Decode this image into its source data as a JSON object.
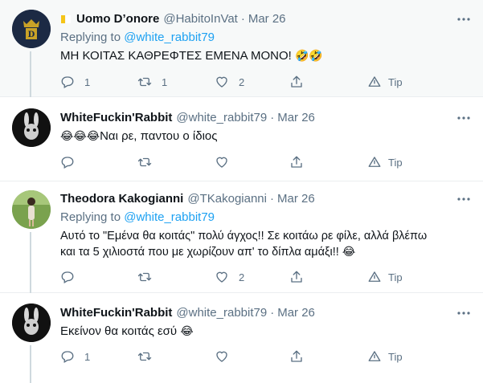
{
  "tweets": [
    {
      "name": "Uomo D’onore",
      "handle": "@HabitoInVat",
      "date": "Mar 26",
      "replying_prefix": "Replying to",
      "replying_to": "@white_rabbit79",
      "text": "ΜΗ ΚΟΙΤΑΣ ΚΑΘΡΕΦΤΕΣ ΕΜΕΝΑ ΜΟΝΟ!",
      "text_emoji": "🤣🤣",
      "reply_count": "1",
      "retweet_count": "1",
      "like_count": "2",
      "tip_label": "Tip"
    },
    {
      "name": "WhiteFuckin'Rabbit",
      "handle": "@white_rabbit79",
      "date": "Mar 26",
      "text_emoji": "😂😂😂",
      "text": "Ναι ρε, παντου ο ίδιος",
      "tip_label": "Tip"
    },
    {
      "name": "Theodora Kakogianni",
      "handle": "@TKakogianni",
      "date": "Mar 26",
      "replying_prefix": "Replying to",
      "replying_to": "@white_rabbit79",
      "text_line1": "Αυτό το \"Εμένα θα κοιτάς\" πολύ άγχος!! Σε κοιτάω ρε φίλε, αλλά βλέπω",
      "text_line2": "και τα 5 χιλιοστά που με χωρίζουν απ' το δίπλα αμάξι!!",
      "text_emoji": "😂",
      "like_count": "2",
      "tip_label": "Tip"
    },
    {
      "name": "WhiteFuckin'Rabbit",
      "handle": "@white_rabbit79",
      "date": "Mar 26",
      "text": "Εκείνον θα κοιτάς εσύ",
      "text_emoji": "😂",
      "reply_count": "1",
      "tip_label": "Tip"
    }
  ],
  "separator": "·",
  "icons": [
    "verified-crown-icon",
    "more-icon",
    "reply-icon",
    "retweet-icon",
    "like-icon",
    "share-icon",
    "tip-icon"
  ],
  "colors": {
    "text": "#0f1419",
    "secondary": "#5b7083",
    "link": "#1da1f2",
    "highlight_bg": "#f7f9f9",
    "border": "#ebeef0",
    "thread_line": "#cfd9de"
  }
}
